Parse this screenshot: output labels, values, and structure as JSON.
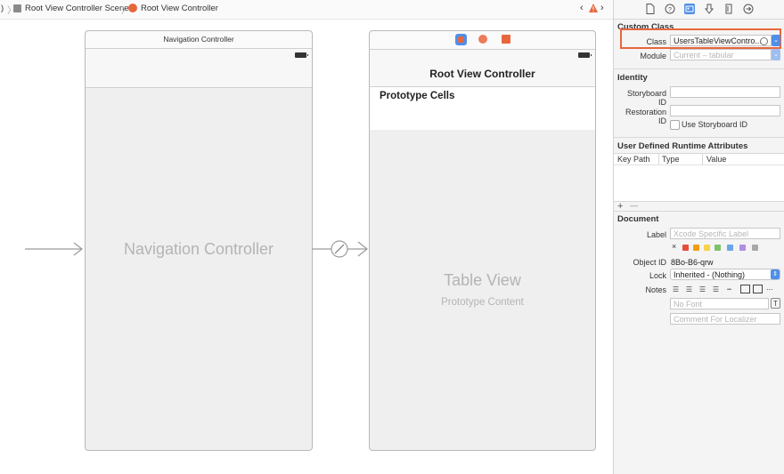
{
  "jumpbar": {
    "lead": ")",
    "scene": "Root View Controller Scene",
    "controller": "Root View Controller",
    "warning_icon": "warning-icon"
  },
  "canvas": {
    "nav_controller": {
      "title": "Navigation Controller",
      "big_label": "Navigation Controller"
    },
    "root_controller": {
      "title": "Root View Controller",
      "prototype_cells": "Prototype Cells",
      "table_view": "Table View",
      "prototype_content": "Prototype Content"
    }
  },
  "inspector": {
    "custom_class": {
      "header": "Custom Class",
      "class_label": "Class",
      "class_value": "UsersTableViewContro...",
      "module_label": "Module",
      "module_placeholder": "Current – tabular"
    },
    "identity": {
      "header": "Identity",
      "storyboard_id_label": "Storyboard ID",
      "storyboard_id_value": "",
      "restoration_id_label": "Restoration ID",
      "restoration_id_value": "",
      "use_storyboard_id": "Use Storyboard ID"
    },
    "udra": {
      "header": "User Defined Runtime Attributes",
      "columns": [
        "Key Path",
        "Type",
        "Value"
      ],
      "add": "+",
      "remove": "—"
    },
    "document": {
      "header": "Document",
      "label_label": "Label",
      "label_placeholder": "Xcode Specific Label",
      "clear_icon": "×",
      "object_id_label": "Object ID",
      "object_id_value": "8Bo-B6-qrw",
      "lock_label": "Lock",
      "lock_value": "Inherited - (Nothing)",
      "notes_label": "Notes",
      "font_placeholder": "No Font",
      "localizer_placeholder": "Comment For Localizer",
      "more": "..."
    }
  },
  "colors": {
    "highlight": "#e8663d",
    "accent": "#4f8fe8"
  }
}
